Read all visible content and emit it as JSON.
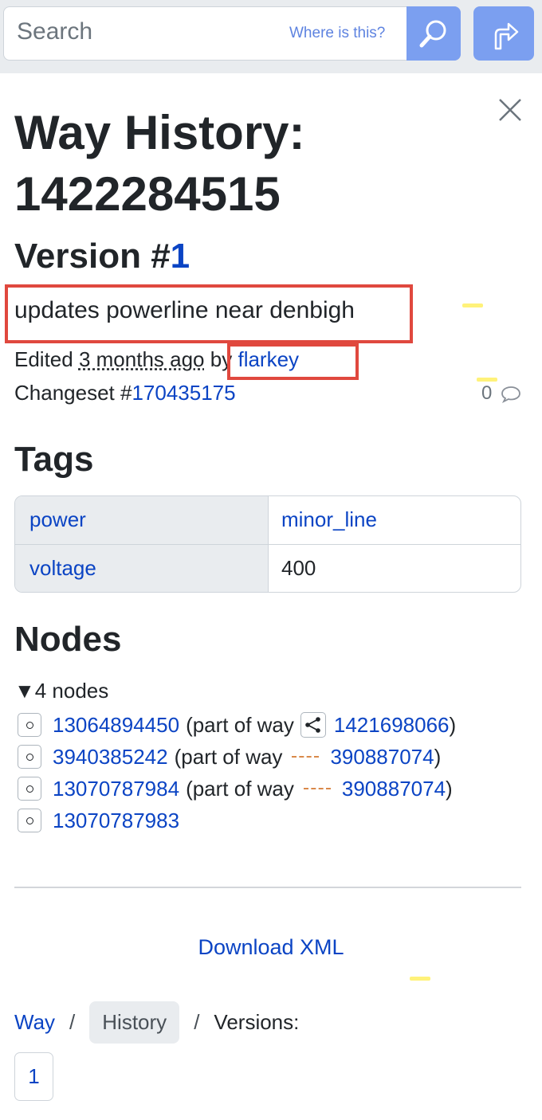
{
  "header": {
    "search_placeholder": "Search",
    "where_link": "Where is this?",
    "search_icon": "magnifier-icon",
    "directions_icon": "directions-icon"
  },
  "panel": {
    "close_icon": "close-icon",
    "title_line1": "Way History:",
    "title_line2": "1422284515",
    "version_label": "Version #",
    "version_number": "1",
    "comment": "updates powerline near denbigh",
    "edited_prefix": "Edited",
    "edited_ago": "3 months ago",
    "by_label": "by",
    "user": "flarkey",
    "changeset_label": "Changeset #",
    "changeset_id": "170435175",
    "comment_count": "0"
  },
  "tags": {
    "heading": "Tags",
    "rows": [
      {
        "key": "power",
        "value": "minor_line"
      },
      {
        "key": "voltage",
        "value": "400"
      }
    ]
  },
  "nodes": {
    "heading": "Nodes",
    "summary": "4 nodes",
    "items": [
      {
        "id": "13064894450",
        "part_of": "(part of way",
        "way_id": "1421698066",
        "close": ")",
        "way_icon": "share-way-icon"
      },
      {
        "id": "3940385242",
        "part_of": "(part of way",
        "way_id": "390887074",
        "close": ")",
        "way_icon": "dashed-line-icon"
      },
      {
        "id": "13070787984",
        "part_of": "(part of way",
        "way_id": "390887074",
        "close": ")",
        "way_icon": "dashed-line-icon"
      },
      {
        "id": "13070787983"
      }
    ]
  },
  "footer": {
    "download": "Download XML",
    "breadcrumb": {
      "way": "Way",
      "sep": "/",
      "history": "History",
      "versions": "Versions:"
    },
    "versions": [
      "1"
    ]
  },
  "colors": {
    "link": "#0b44c4",
    "button": "#7b9ff0",
    "highlight_box": "#e0483e"
  }
}
